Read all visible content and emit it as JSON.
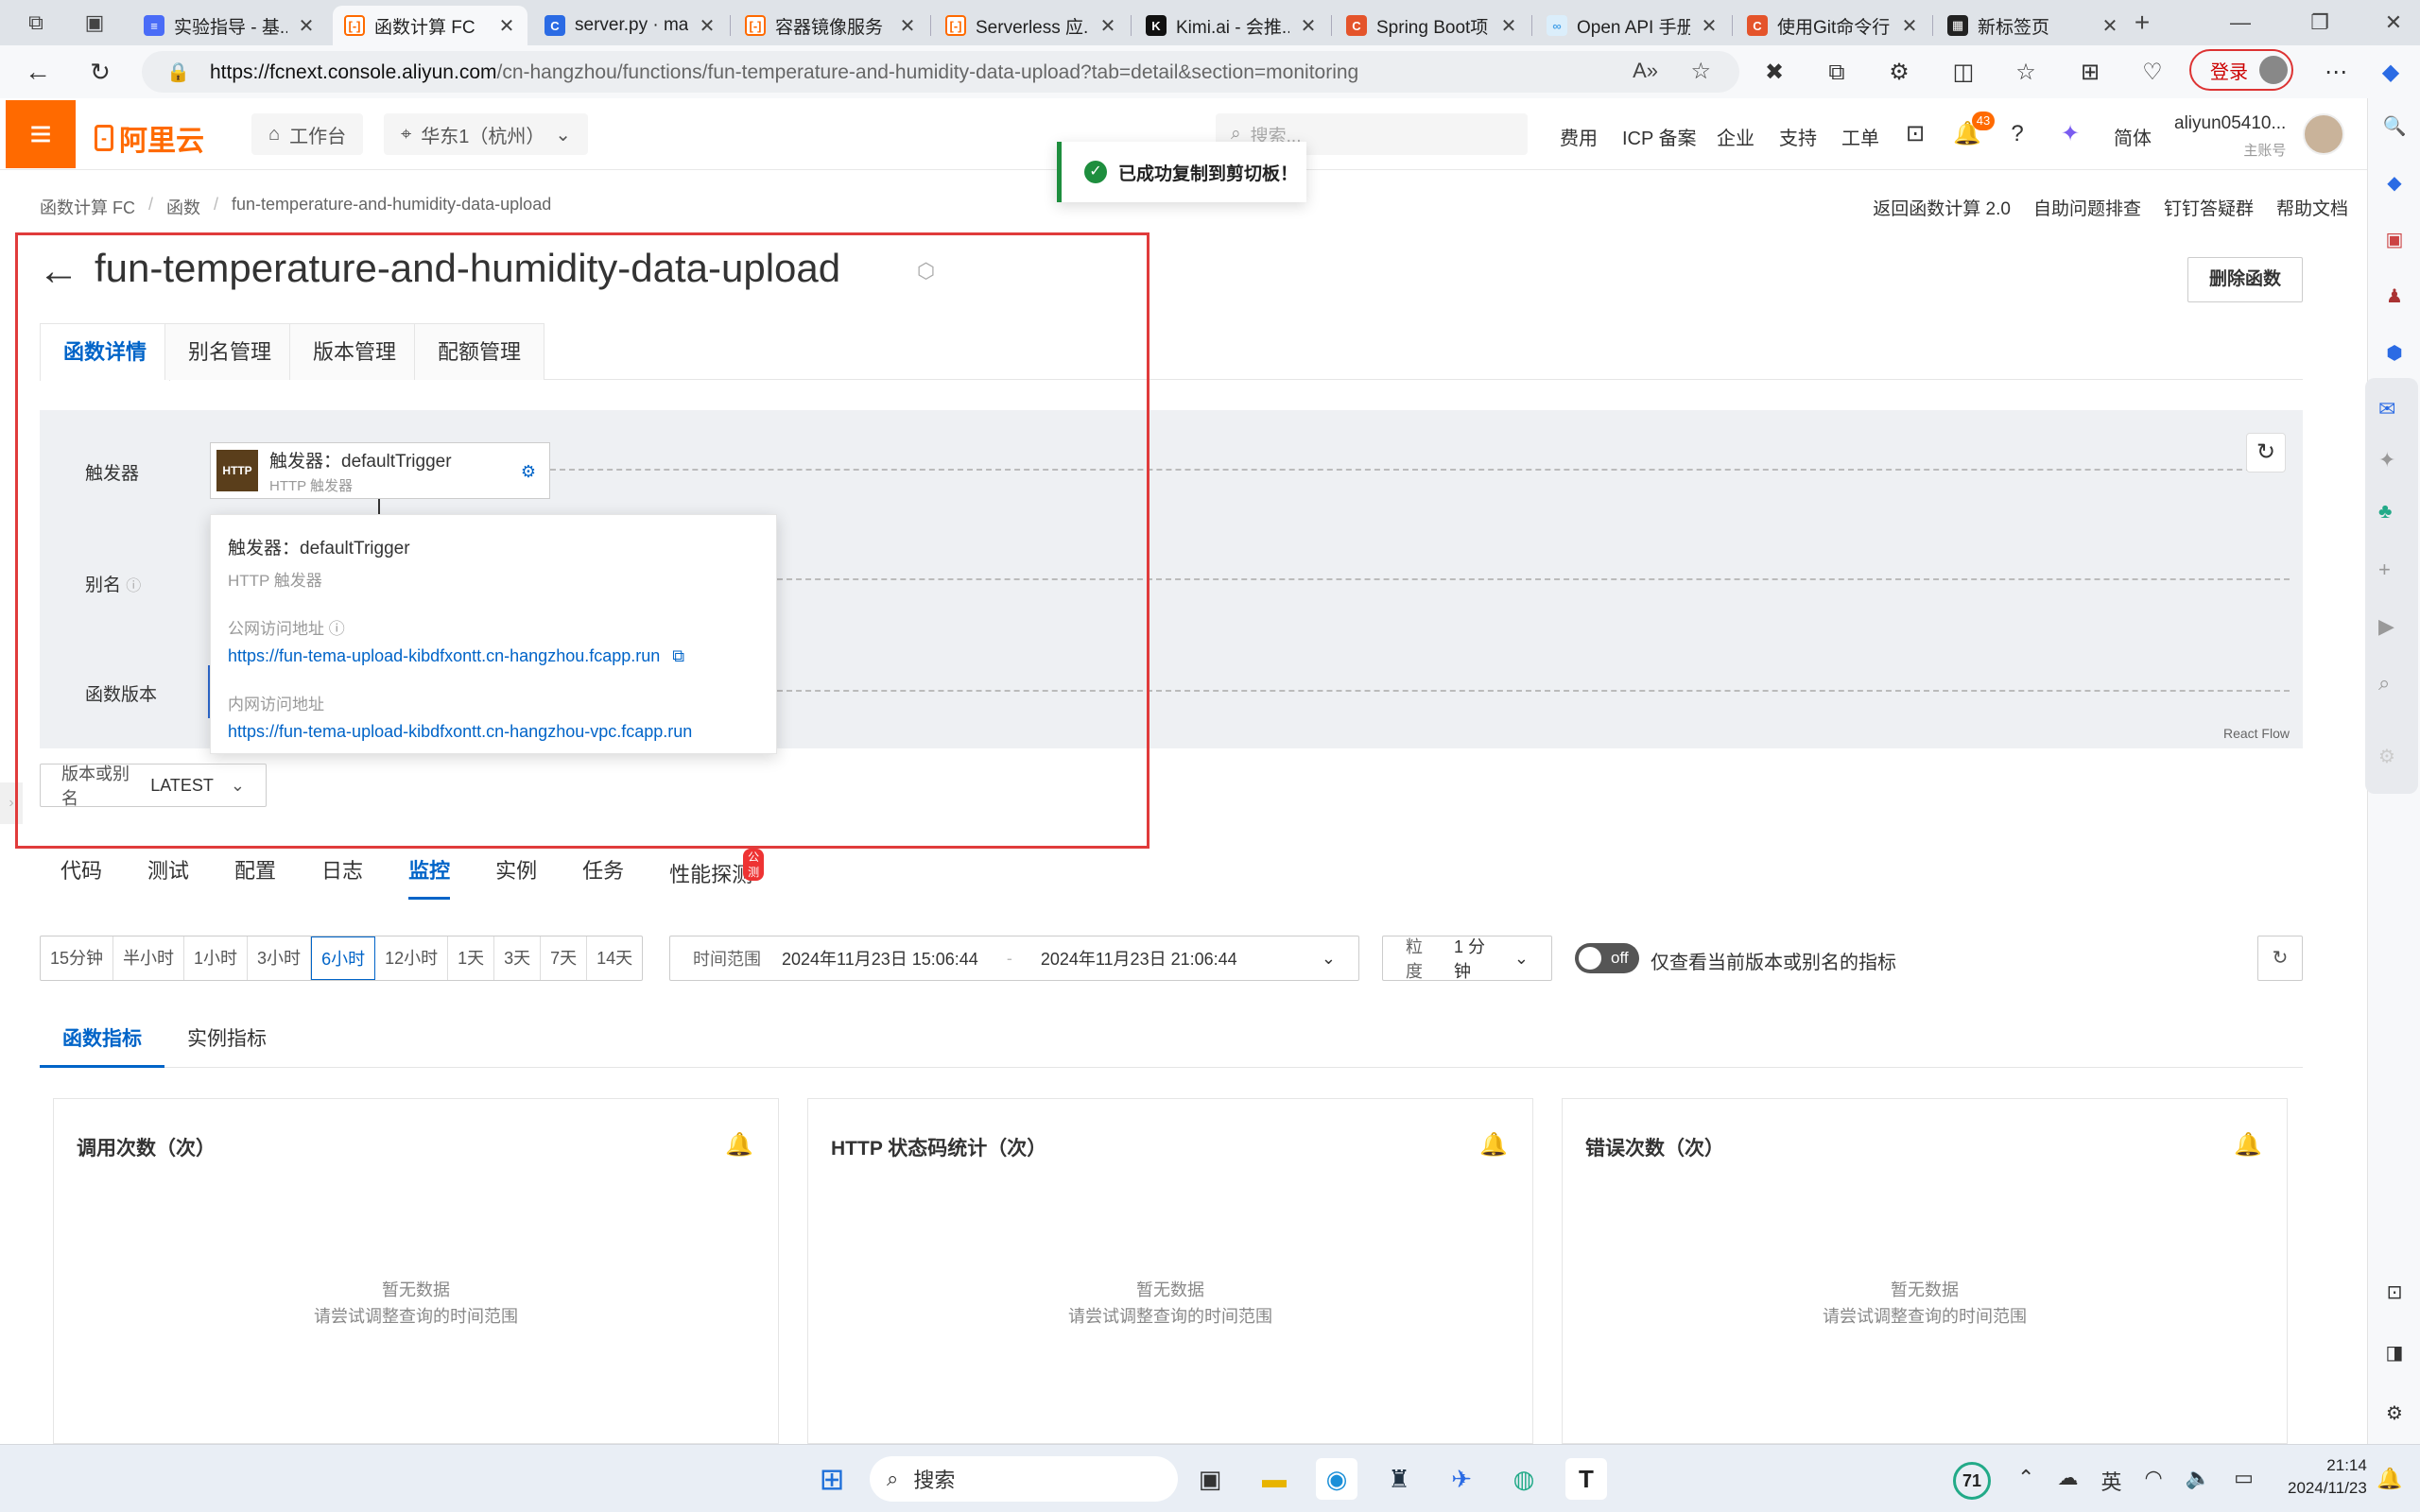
{
  "browser": {
    "tabs": [
      {
        "label": "实验指导 - 基...",
        "favicon_color": "#4a6cf7"
      },
      {
        "label": "函数计算 FC",
        "favicon_color": "#ff6a00",
        "active": true
      },
      {
        "label": "server.py · ma...",
        "favicon_color": "#2b6be4"
      },
      {
        "label": "容器镜像服务",
        "favicon_color": "#ff6a00"
      },
      {
        "label": "Serverless 应...",
        "favicon_color": "#ff6a00"
      },
      {
        "label": "Kimi.ai - 会推...",
        "favicon_color": "#111111"
      },
      {
        "label": "Spring Boot项...",
        "favicon_color": "#e4542b"
      },
      {
        "label": "Open API 手册...",
        "favicon_color": "#4aa3e8"
      },
      {
        "label": "使用Git命令行...",
        "favicon_color": "#e4542b"
      },
      {
        "label": "新标签页",
        "favicon_color": "#222222"
      }
    ],
    "url_host": "https://fcnext.console.aliyun.com",
    "url_path": "/cn-hangzhou/functions/fun-temperature-and-humidity-data-upload?tab=detail&section=monitoring",
    "login_label": "登录"
  },
  "topnav": {
    "logo": "阿里云",
    "workbench": "工作台",
    "region": "华东1（杭州）",
    "search_placeholder": "搜索...",
    "links": [
      "费用",
      "ICP 备案",
      "企业",
      "支持",
      "工单"
    ],
    "notification_count": "43",
    "lang": "简体",
    "account": "aliyun05410...",
    "account_role": "主账号"
  },
  "toast": "已成功复制到剪切板！",
  "breadcrumb": [
    "函数计算 FC",
    "函数",
    "fun-temperature-and-humidity-data-upload"
  ],
  "quicklinks": [
    "返回函数计算 2.0",
    "自助问题排查",
    "钉钉答疑群",
    "帮助文档"
  ],
  "page": {
    "title": "fun-temperature-and-humidity-data-upload",
    "delete_label": "删除函数",
    "tabs": [
      "函数详情",
      "别名管理",
      "版本管理",
      "配额管理"
    ]
  },
  "flow": {
    "row_labels": [
      "触发器",
      "别名",
      "函数版本"
    ],
    "trigger_name": "触发器：defaultTrigger",
    "trigger_type": "HTTP 触发器",
    "trigger_badge": "HTTP",
    "react_flow": "React Flow"
  },
  "popover": {
    "name": "触发器：defaultTrigger",
    "type": "HTTP 触发器",
    "public_label": "公网访问地址",
    "public_url": "https://fun-tema-upload-kibdfxontt.cn-hangzhou.fcapp.run",
    "internal_label": "内网访问地址",
    "internal_url": "https://fun-tema-upload-kibdfxontt.cn-hangzhou-vpc.fcapp.run"
  },
  "version_select": {
    "label": "版本或别名",
    "value": "LATEST"
  },
  "subtabs": [
    "代码",
    "测试",
    "配置",
    "日志",
    "监控",
    "实例",
    "任务",
    "性能探测"
  ],
  "subtab_badge": "公测",
  "time": {
    "quick": [
      "15分钟",
      "半小时",
      "1小时",
      "3小时",
      "6小时",
      "12小时",
      "1天",
      "3天",
      "7天",
      "14天"
    ],
    "range_label": "时间范围",
    "start": "2024年11月23日 15:06:44",
    "end": "2024年11月23日 21:06:44",
    "range_separator": "-",
    "granularity_label": "粒度",
    "granularity_value": "1 分钟",
    "toggle_text": "off",
    "toggle_label": "仅查看当前版本或别名的指标"
  },
  "metric_tabs": [
    "函数指标",
    "实例指标"
  ],
  "cards": [
    {
      "title": "调用次数（次）",
      "empty": "暂无数据",
      "hint": "请尝试调整查询的时间范围"
    },
    {
      "title": "HTTP 状态码统计（次）",
      "empty": "暂无数据",
      "hint": "请尝试调整查询的时间范围"
    },
    {
      "title": "错误次数（次）",
      "empty": "暂无数据",
      "hint": "请尝试调整查询的时间范围"
    }
  ],
  "taskbar": {
    "search": "搜索",
    "weather": "71",
    "ime": "英",
    "time": "21:14",
    "date": "2024/11/23"
  }
}
